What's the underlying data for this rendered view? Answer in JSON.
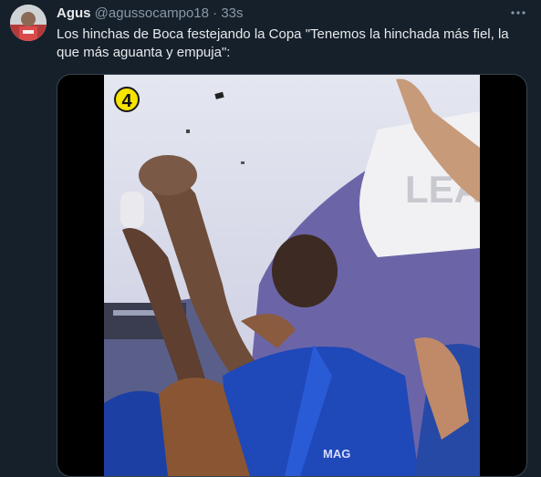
{
  "tweet": {
    "display_name": "Agus",
    "handle": "@agussocampo18",
    "separator": "·",
    "time": "33s",
    "more_icon": "ellipsis-icon",
    "text": "Los hinchas de Boca festejando la Copa \"Tenemos la hinchada más fiel, la que más aguanta y empuja\":"
  },
  "media": {
    "badge": "4",
    "sign_text": "LEA",
    "shirt_text": "MAG"
  },
  "colors": {
    "background": "#15202b",
    "text": "#e7e9ea",
    "secondary_text": "#8b98a5",
    "border": "#38444d",
    "shirt_blue": "#1f48b8"
  }
}
